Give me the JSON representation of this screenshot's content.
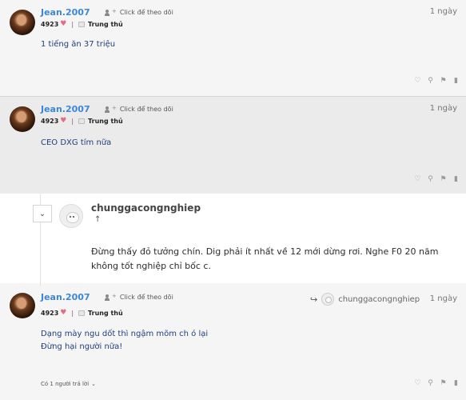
{
  "posts": [
    {
      "username": "Jean.2007",
      "follow_label": "Click để theo dõi",
      "likes": "4923",
      "title": "Trung thủ",
      "time": "1 ngày",
      "content": [
        "1 tiếng ăn 37 triệu"
      ]
    },
    {
      "username": "Jean.2007",
      "follow_label": "Click để theo dõi",
      "likes": "4923",
      "title": "Trung thủ",
      "time": "1 ngày",
      "content": [
        "CEO DXG tím nữa"
      ]
    },
    {
      "username": "Jean.2007",
      "follow_label": "Click để theo dõi",
      "likes": "4923",
      "title": "Trung thủ",
      "time": "1 ngày",
      "reply_to": "chunggacongnghiep",
      "content": [
        "Dạng mày ngu dốt thì ngậm mõm ch ó lại",
        "Đừng hại người nữa!"
      ],
      "replies": "Có 1 người trả lời"
    }
  ],
  "quote": {
    "username": "chunggacongnghiep",
    "text": "Đừng thấy đỏ tưởng chín. Dig phải ít nhất về 12 mới dừng rơi. Nghe F0 20 năm không tốt nghiệp chỉ bốc c."
  },
  "icons": {
    "heart_color": "#e46b82",
    "link_color": "#3d87d4"
  }
}
